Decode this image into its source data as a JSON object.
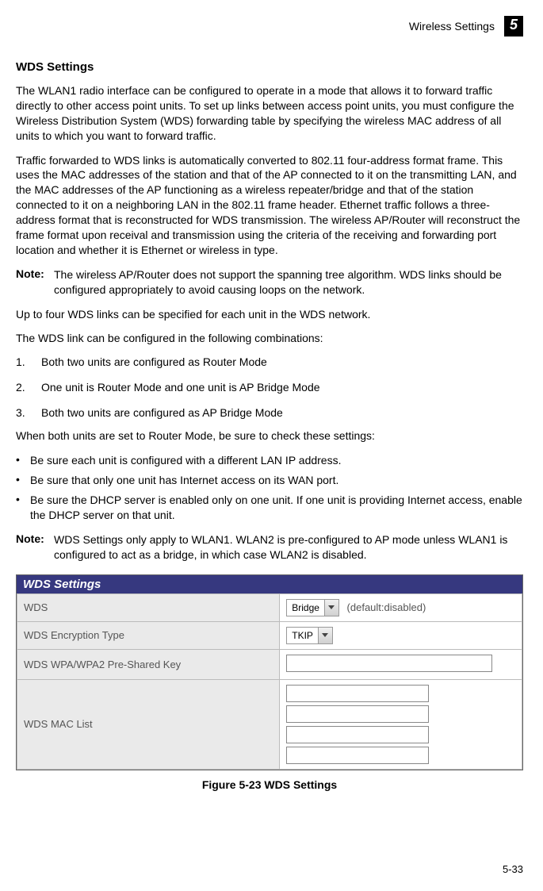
{
  "header": {
    "title": "Wireless Settings",
    "section_number": "5"
  },
  "section": {
    "heading": "WDS Settings",
    "para1": "The WLAN1 radio interface can be configured to operate in a mode that allows it to forward traffic directly to other access point units. To set up links between access point units, you must configure the Wireless Distribution System (WDS) forwarding table by specifying the wireless MAC address of all units to which you want to forward traffic.",
    "para2": "Traffic forwarded to WDS links is automatically converted to 802.11 four-address format frame. This uses the MAC addresses of the station and that of the AP connected to it on the transmitting LAN, and the MAC addresses of the AP functioning as a wireless repeater/bridge and that of the station connected to it on a neighboring LAN in the 802.11 frame header. Ethernet traffic follows a three-address format that is reconstructed for WDS transmission. The wireless AP/Router will reconstruct the frame format upon receival and transmission using the criteria of the receiving and forwarding port location and whether it is Ethernet or wireless in type.",
    "note1_label": "Note:",
    "note1_text": "The wireless AP/Router does not support the spanning tree algorithm. WDS links should be configured appropriately to avoid causing loops on the network.",
    "para3": "Up to four WDS links can be specified for each unit in the WDS network.",
    "para4": "The WDS link can be configured in the following combinations:",
    "list": {
      "i1_num": "1.",
      "i1_text": "Both two units are configured as Router Mode",
      "i2_num": "2.",
      "i2_text": "One unit is Router Mode and one unit is AP Bridge Mode",
      "i3_num": "3.",
      "i3_text": "Both two units are configured as AP Bridge Mode"
    },
    "para5": "When both units are set to Router Mode, be sure to check these settings:",
    "bullets": {
      "b1": "Be sure each unit is configured with a different LAN IP address.",
      "b2": "Be sure that only one unit has Internet access on its WAN port.",
      "b3": "Be sure the DHCP server is enabled only on one unit. If one unit is providing Internet access, enable the DHCP server on that unit."
    },
    "note2_label": "Note:",
    "note2_text": "WDS Settings only apply to WLAN1. WLAN2 is pre-configured to AP mode unless WLAN1 is configured to act as a bridge, in which case WLAN2 is disabled."
  },
  "figure": {
    "panel_title": "WDS Settings",
    "rows": {
      "wds_label": "WDS",
      "wds_value": "Bridge",
      "wds_hint": "(default:disabled)",
      "enc_label": "WDS Encryption Type",
      "enc_value": "TKIP",
      "psk_label": "WDS WPA/WPA2 Pre-Shared Key",
      "mac_label": "WDS MAC List"
    },
    "caption": "Figure 5-23  WDS Settings"
  },
  "footer": {
    "page": "5-33"
  },
  "bullet_char": "•"
}
